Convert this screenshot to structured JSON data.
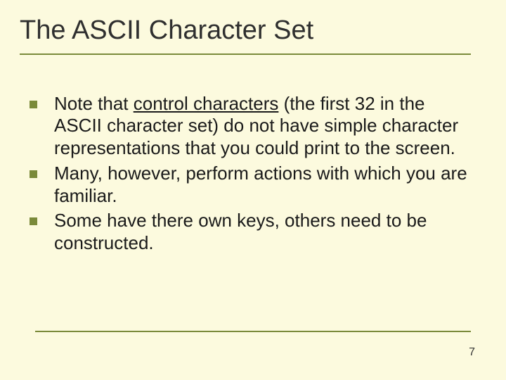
{
  "title": "The ASCII Character Set",
  "bullets": [
    {
      "pre": "Note that ",
      "underlined": "control characters",
      "post": " (the first 32 in the ASCII character set) do not have simple character representations that you could print to the screen."
    },
    {
      "pre": "Many, however, perform actions with which you are familiar.",
      "underlined": "",
      "post": ""
    },
    {
      "pre": "Some have there own keys, others need to be constructed.",
      "underlined": "",
      "post": ""
    }
  ],
  "page_number": "7"
}
